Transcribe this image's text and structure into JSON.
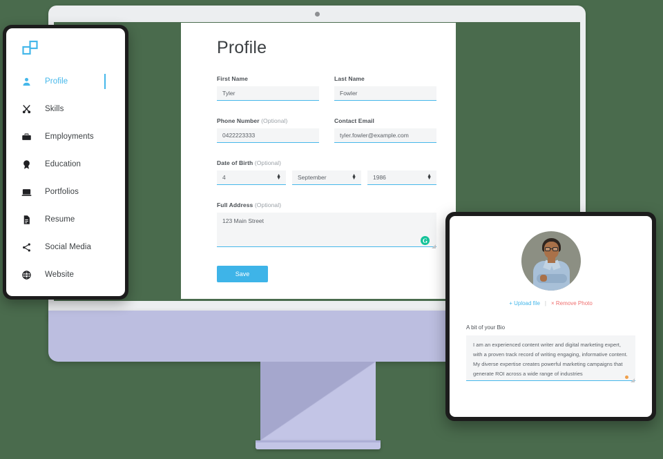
{
  "colors": {
    "background": "#4a6b4d",
    "accent": "#44b7ea",
    "save_button": "#3eb4e8",
    "remove_link": "#ef6e6e",
    "grammarly_green": "#15c39a",
    "monitor_chin": "#bcbee0"
  },
  "sidebar": {
    "logo_name": "app-logo-icon",
    "items": [
      {
        "label": "Profile",
        "icon": "person-icon",
        "active": true
      },
      {
        "label": "Skills",
        "icon": "scissors-icon",
        "active": false
      },
      {
        "label": "Employments",
        "icon": "briefcase-icon",
        "active": false
      },
      {
        "label": "Education",
        "icon": "award-icon",
        "active": false
      },
      {
        "label": "Portfolios",
        "icon": "laptop-icon",
        "active": false
      },
      {
        "label": "Resume",
        "icon": "document-icon",
        "active": false
      },
      {
        "label": "Social Media",
        "icon": "share-icon",
        "active": false
      },
      {
        "label": "Website",
        "icon": "globe-icon",
        "active": false
      }
    ]
  },
  "form": {
    "title": "Profile",
    "first_name": {
      "label": "First Name",
      "value": "Tyler"
    },
    "last_name": {
      "label": "Last Name",
      "value": "Fowler"
    },
    "phone": {
      "label": "Phone Number",
      "optional": "(Optional)",
      "value": "0422223333"
    },
    "email": {
      "label": "Contact Email",
      "value": "tyler.fowler@example.com"
    },
    "dob": {
      "label": "Date of Birth",
      "optional": "(Optional)",
      "day": "4",
      "month": "September",
      "year": "1986"
    },
    "address": {
      "label": "Full Address",
      "optional": "(Optional)",
      "value": "123 Main Street",
      "assistant_icon": "grammarly-icon"
    },
    "save_label": "Save"
  },
  "photo_panel": {
    "avatar_name": "user-avatar-photo",
    "upload_label": "Upload file",
    "upload_icon": "+",
    "separator": "|",
    "remove_label": "Remove Photo",
    "remove_icon": "×",
    "bio_label": "A bit of your Bio",
    "bio_value": "I am an experienced content writer and digital marketing expert, with a proven track record of writing engaging, informative content. My diverse expertise creates powerful marketing campaigns that generate ROI across a wide range of industries"
  }
}
